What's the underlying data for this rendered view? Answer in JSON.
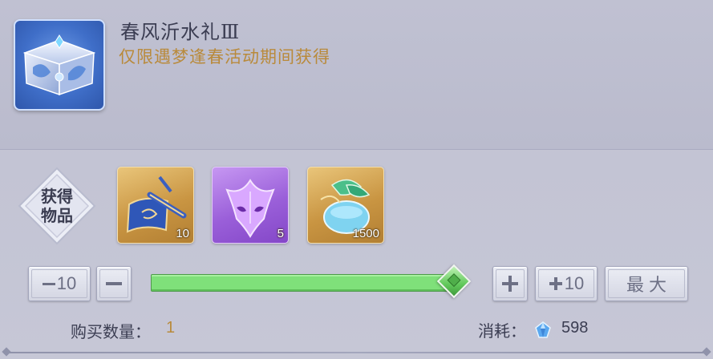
{
  "item": {
    "title": "春风沂水礼Ⅲ",
    "subtitle": "仅限遇梦逢春活动期间获得",
    "icon": "treasure-chest-icon"
  },
  "obtain": {
    "line1": "获得",
    "line2": "物品"
  },
  "rewards": [
    {
      "icon": "feather-scroll-icon",
      "quantity": "10",
      "rarity_color": "#c99542"
    },
    {
      "icon": "purple-mask-icon",
      "quantity": "5",
      "rarity_color": "#9a5fd9"
    },
    {
      "icon": "bottle-leaf-icon",
      "quantity": "1500",
      "rarity_color": "#c99542"
    }
  ],
  "controls": {
    "minus10": "10",
    "plus10": "10",
    "max": "最 大",
    "slider_fraction": 1.0
  },
  "purchase": {
    "quantity_label": "购买数量：",
    "quantity_value": "1",
    "cost_label": "消耗：",
    "cost_value": "598",
    "cost_icon": "blue-crystal-icon"
  },
  "colors": {
    "accent_gold": "#b98a3b",
    "slider_green": "#7fe07a"
  }
}
